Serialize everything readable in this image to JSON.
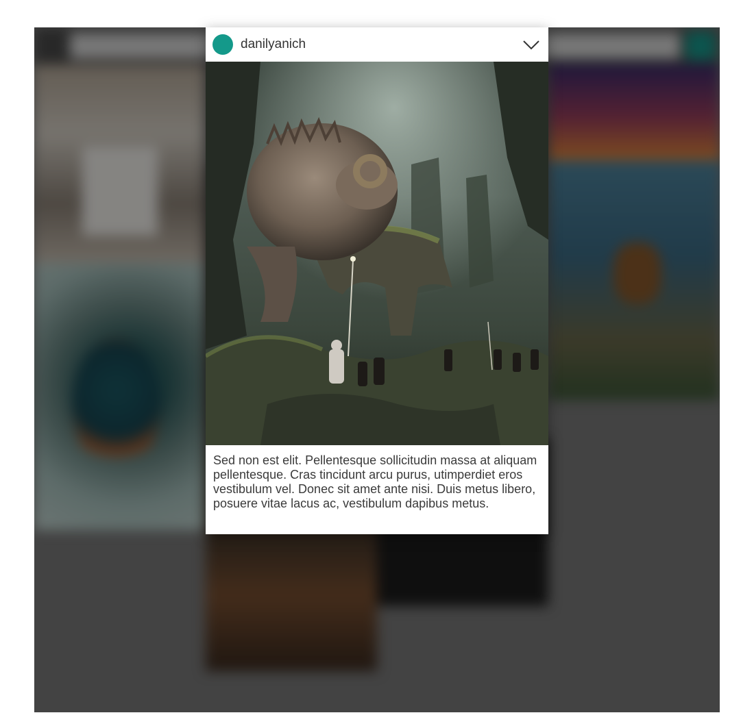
{
  "post": {
    "username": "danilyanich",
    "caption": "Sed non est elit. Pellentesque sollicitudin massa at aliquam pellentesque. Cras tincidunt arcu purus, utimperdiet eros vestibulum vel. Donec sit amet ante nisi. Duis metus libero, posuere vitae lacus ac, vestibulum dapibus metus.",
    "avatar_color": "#14998a",
    "collapse_icon": "chevron-down-icon",
    "image_subject": "fantasy cave scene with giant horned beast and travelers"
  },
  "colors": {
    "accent": "#14998a",
    "overlay": "rgba(0,0,0,0.45)"
  }
}
